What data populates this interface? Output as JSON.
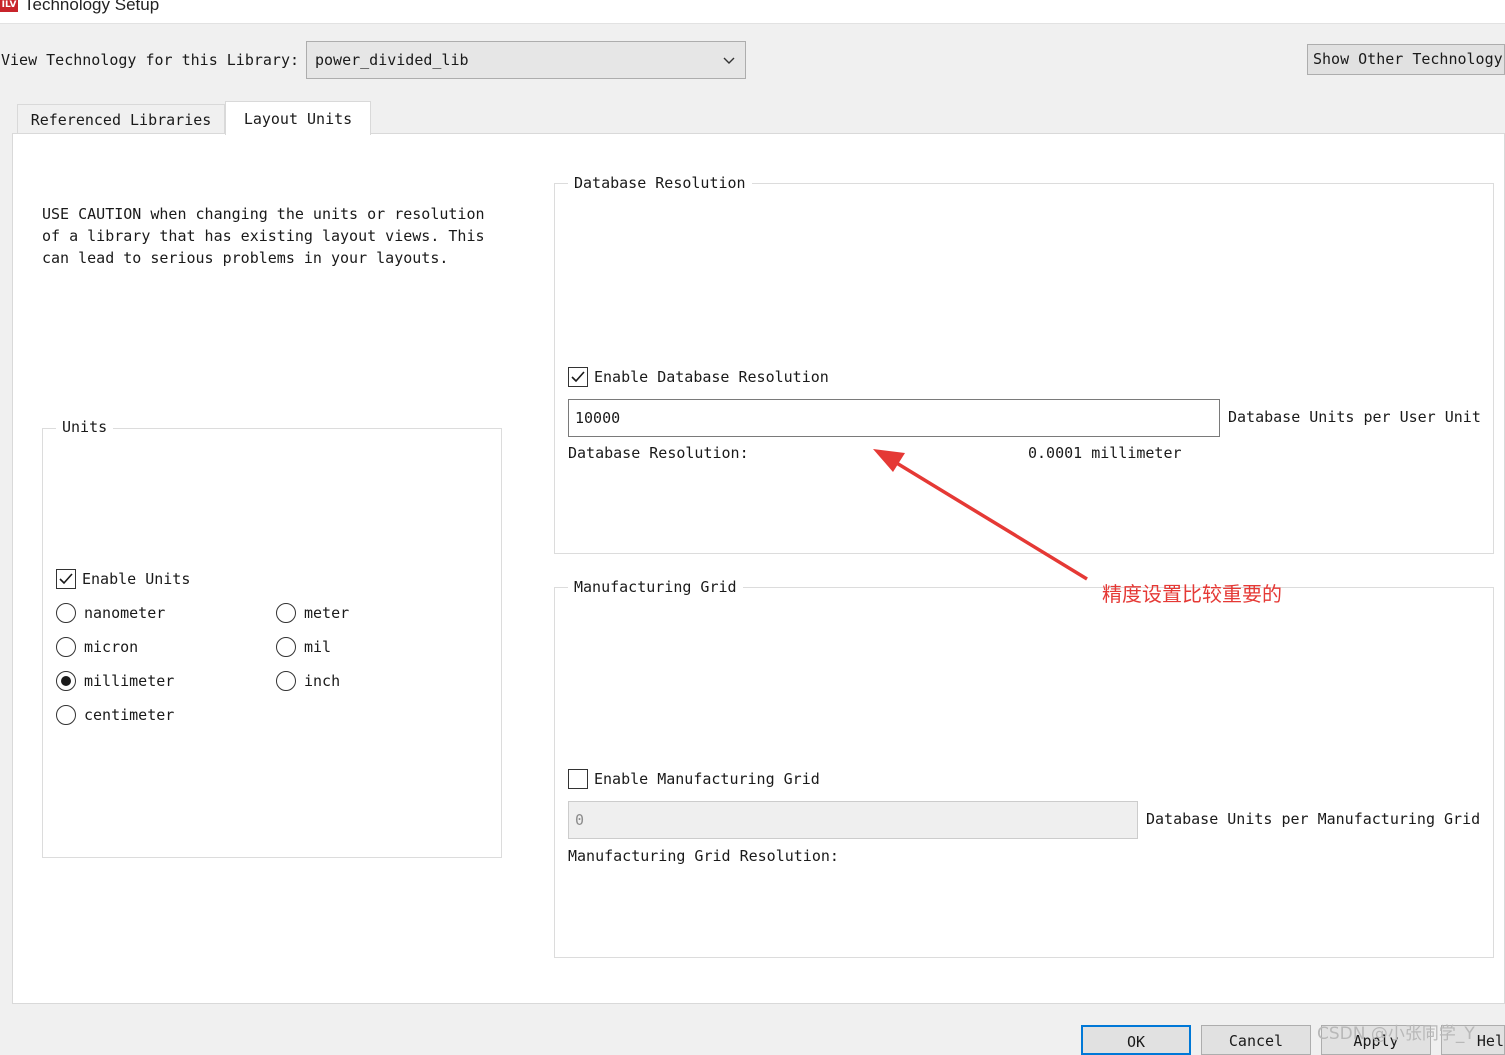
{
  "window": {
    "icon_text": "ILV",
    "title": "Technology Setup"
  },
  "header": {
    "library_label": "View Technology for this Library:",
    "library_value": "power_divided_lib",
    "show_other_button": "Show Other Technology"
  },
  "tabs": [
    {
      "label": "Referenced Libraries",
      "active": false
    },
    {
      "label": "Layout Units",
      "active": true
    }
  ],
  "caution": {
    "lines": [
      "USE CAUTION when changing the units or resolution",
      "of a library that has existing layout views. This",
      "can lead to serious problems in your layouts."
    ]
  },
  "units": {
    "legend": "Units",
    "enable_label": "Enable Units",
    "enable_checked": true,
    "options": {
      "nanometer": "nanometer",
      "micron": "micron",
      "millimeter": "millimeter",
      "centimeter": "centimeter",
      "meter": "meter",
      "mil": "mil",
      "inch": "inch"
    },
    "selected": "millimeter"
  },
  "db_resolution": {
    "legend": "Database Resolution",
    "enable_label": "Enable Database Resolution",
    "enable_checked": true,
    "value": "10000",
    "per_label": "Database Units per User Unit",
    "resolution_label": "Database Resolution:",
    "resolution_value": "0.0001 millimeter"
  },
  "mfg_grid": {
    "legend": "Manufacturing Grid",
    "enable_label": "Enable Manufacturing Grid",
    "enable_checked": false,
    "value": "0",
    "per_label": "Database Units per Manufacturing Grid",
    "resolution_label": "Manufacturing Grid Resolution:"
  },
  "footer": {
    "ok": "OK",
    "cancel": "Cancel",
    "apply": "Apply",
    "help": "Hel"
  },
  "annotation": {
    "text": "精度设置比较重要的",
    "color": "#e53935"
  },
  "watermark": "CSDN @小张同学_Y"
}
